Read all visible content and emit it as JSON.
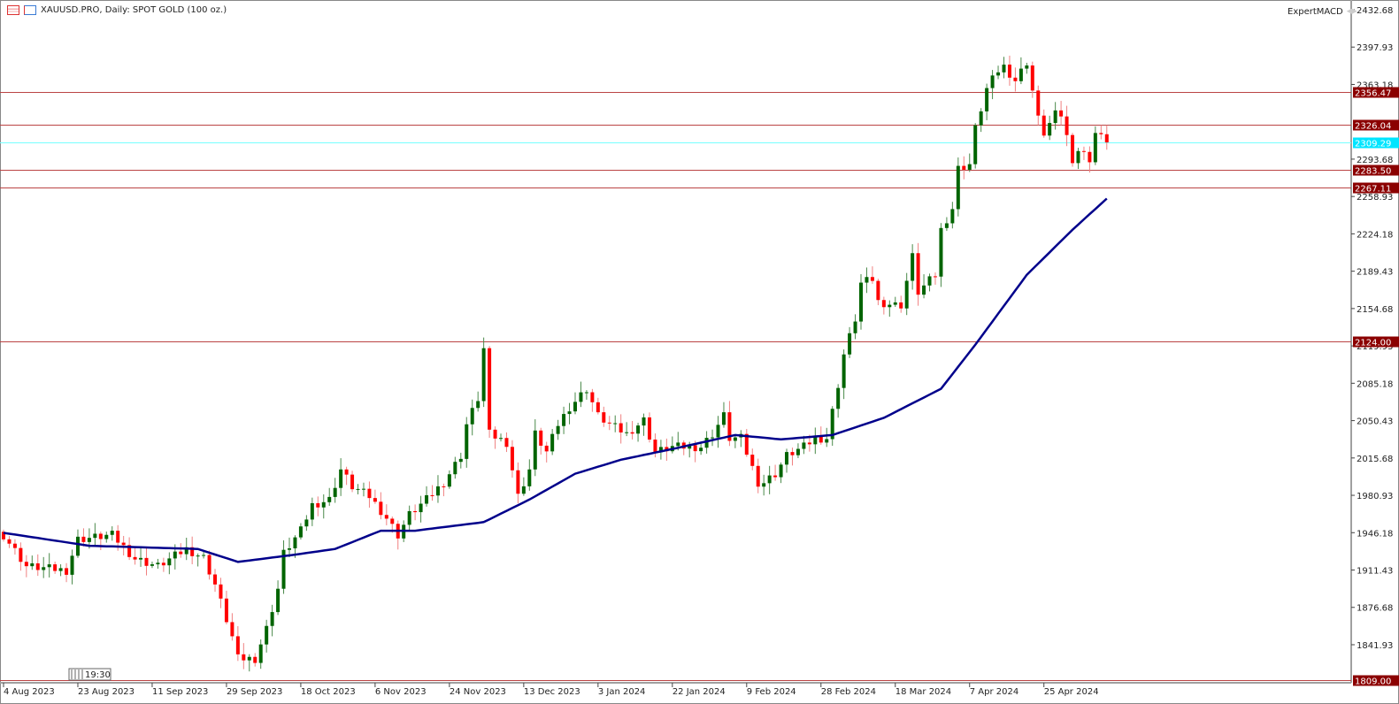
{
  "header": {
    "title": "XAUUSD.PRO, Daily:  SPOT GOLD (100 oz.)",
    "expert": "ExpertMACD"
  },
  "time_marker": "19:30",
  "chart_data": {
    "type": "candlestick",
    "symbol": "XAUUSD.PRO",
    "timeframe": "Daily",
    "ylim": [
      1809.0,
      2432.68
    ],
    "y_ticks": [
      "2432.68",
      "2397.93",
      "2363.18",
      "2293.68",
      "2258.93",
      "2224.18",
      "2189.43",
      "2154.68",
      "2119.93",
      "2085.18",
      "2050.43",
      "2015.68",
      "1980.93",
      "1946.18",
      "1911.43",
      "1876.68",
      "1841.93"
    ],
    "x_ticks": [
      "4 Aug 2023",
      "23 Aug 2023",
      "11 Sep 2023",
      "29 Sep 2023",
      "18 Oct 2023",
      "6 Nov 2023",
      "24 Nov 2023",
      "13 Dec 2023",
      "3 Jan 2024",
      "22 Jan 2024",
      "9 Feb 2024",
      "28 Feb 2024",
      "18 Mar 2024",
      "7 Apr 2024",
      "25 Apr 2024"
    ],
    "bars_per_tick": 13,
    "bar_count": 194,
    "close_keypoints": [
      [
        0,
        1944
      ],
      [
        4,
        1915
      ],
      [
        11,
        1911
      ],
      [
        13,
        1940
      ],
      [
        19,
        1944
      ],
      [
        23,
        1922
      ],
      [
        27,
        1915
      ],
      [
        32,
        1931
      ],
      [
        35,
        1923
      ],
      [
        37,
        1898
      ],
      [
        40,
        1849
      ],
      [
        41,
        1829
      ],
      [
        44,
        1829
      ],
      [
        46,
        1857
      ],
      [
        48,
        1894
      ],
      [
        49,
        1927
      ],
      [
        52,
        1948
      ],
      [
        54,
        1972
      ],
      [
        57,
        1977
      ],
      [
        59,
        2005
      ],
      [
        61,
        1989
      ],
      [
        64,
        1980
      ],
      [
        67,
        1960
      ],
      [
        69,
        1944
      ],
      [
        71,
        1963
      ],
      [
        74,
        1977
      ],
      [
        77,
        1993
      ],
      [
        80,
        2018
      ],
      [
        81,
        2047
      ],
      [
        83,
        2071
      ],
      [
        84,
        2117
      ],
      [
        85,
        2038
      ],
      [
        88,
        2030
      ],
      [
        90,
        1980
      ],
      [
        92,
        2005
      ],
      [
        93,
        2038
      ],
      [
        95,
        2021
      ],
      [
        97,
        2047
      ],
      [
        99,
        2063
      ],
      [
        102,
        2080
      ],
      [
        104,
        2055
      ],
      [
        106,
        2047
      ],
      [
        109,
        2038
      ],
      [
        112,
        2051
      ],
      [
        114,
        2021
      ],
      [
        117,
        2026
      ],
      [
        120,
        2026
      ],
      [
        122,
        2026
      ],
      [
        124,
        2038
      ],
      [
        126,
        2055
      ],
      [
        127,
        2034
      ],
      [
        129,
        2034
      ],
      [
        132,
        1993
      ],
      [
        133,
        1993
      ],
      [
        135,
        2001
      ],
      [
        137,
        2018
      ],
      [
        140,
        2026
      ],
      [
        142,
        2034
      ],
      [
        144,
        2034
      ],
      [
        146,
        2084
      ],
      [
        147,
        2112
      ],
      [
        149,
        2145
      ],
      [
        150,
        2178
      ],
      [
        152,
        2182
      ],
      [
        153,
        2161
      ],
      [
        156,
        2158
      ],
      [
        157,
        2158
      ],
      [
        159,
        2203
      ],
      [
        160,
        2170
      ],
      [
        163,
        2186
      ],
      [
        164,
        2228
      ],
      [
        166,
        2248
      ],
      [
        167,
        2285
      ],
      [
        169,
        2289
      ],
      [
        170,
        2322
      ],
      [
        172,
        2359
      ],
      [
        174,
        2376
      ],
      [
        175,
        2380
      ],
      [
        177,
        2367
      ],
      [
        179,
        2384
      ],
      [
        181,
        2331
      ],
      [
        182,
        2318
      ],
      [
        184,
        2335
      ],
      [
        185,
        2335
      ],
      [
        187,
        2294
      ],
      [
        188,
        2302
      ],
      [
        190,
        2294
      ],
      [
        191,
        2318
      ],
      [
        193,
        2309.29
      ]
    ],
    "ma_keypoints": [
      [
        0,
        1946
      ],
      [
        15,
        1934
      ],
      [
        34,
        1931
      ],
      [
        41,
        1919
      ],
      [
        50,
        1925
      ],
      [
        58,
        1931
      ],
      [
        66,
        1948
      ],
      [
        72,
        1948
      ],
      [
        84,
        1956
      ],
      [
        92,
        1977
      ],
      [
        100,
        2001
      ],
      [
        108,
        2014
      ],
      [
        117,
        2024
      ],
      [
        128,
        2037
      ],
      [
        136,
        2033
      ],
      [
        145,
        2037
      ],
      [
        154,
        2053
      ],
      [
        164,
        2080
      ],
      [
        170,
        2121
      ],
      [
        179,
        2186
      ],
      [
        187,
        2228
      ],
      [
        193,
        2257
      ]
    ],
    "levels": [
      {
        "price": "2356.47",
        "color": "#8b0000"
      },
      {
        "price": "2326.04",
        "color": "#8b0000"
      },
      {
        "price": "2309.29",
        "color": "#00e5ff"
      },
      {
        "price": "2283.50",
        "color": "#8b0000"
      },
      {
        "price": "2267.11",
        "color": "#8b0000"
      },
      {
        "price": "2124.00",
        "color": "#8b0000"
      },
      {
        "price": "1809.00",
        "color": "#8b0000"
      }
    ],
    "colors": {
      "up": "#006400",
      "down": "#ff0000",
      "ma": "#00008b",
      "axis": "#a0a0a0"
    }
  }
}
